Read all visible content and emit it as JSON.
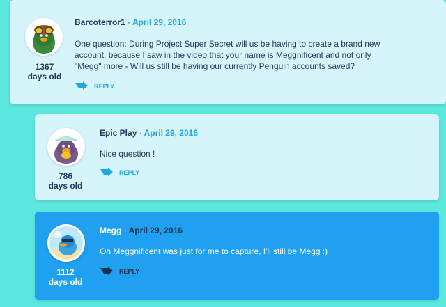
{
  "colors": {
    "background": "#5ce8de",
    "comment_bg": "#d6f5fb",
    "highlight_bg": "#1fa0f0",
    "accent": "#1fa8e0",
    "text_dark": "#1d3b5a"
  },
  "comments": [
    {
      "author": "Barcoterror1",
      "separator": "·",
      "date": "April 29, 2016",
      "age_number": "1367",
      "age_label": "days old",
      "text": "One question: During Project Super Secret will us be having to create a brand new account, because I saw in the video that your name is Meggnificent and not only \"Megg\" more - Will us still be having our currently Penguin accounts saved?",
      "reply_label": "REPLY",
      "avatar_icon": "penguin-aviator-avatar"
    },
    {
      "author": "Epic Play",
      "separator": "·",
      "date": "April 29, 2016",
      "age_number": "786",
      "age_label": "days old",
      "text": "Nice question !",
      "reply_label": "REPLY",
      "avatar_icon": "penguin-hat-avatar"
    },
    {
      "author": "Megg",
      "separator": "·",
      "date": "April 29, 2016",
      "age_number": "1112",
      "age_label": "days old",
      "text": "Oh Meggnificent was just for me to capture, I'll still be Megg :)",
      "reply_label": "REPLY",
      "avatar_icon": "penguin-beach-avatar"
    }
  ]
}
